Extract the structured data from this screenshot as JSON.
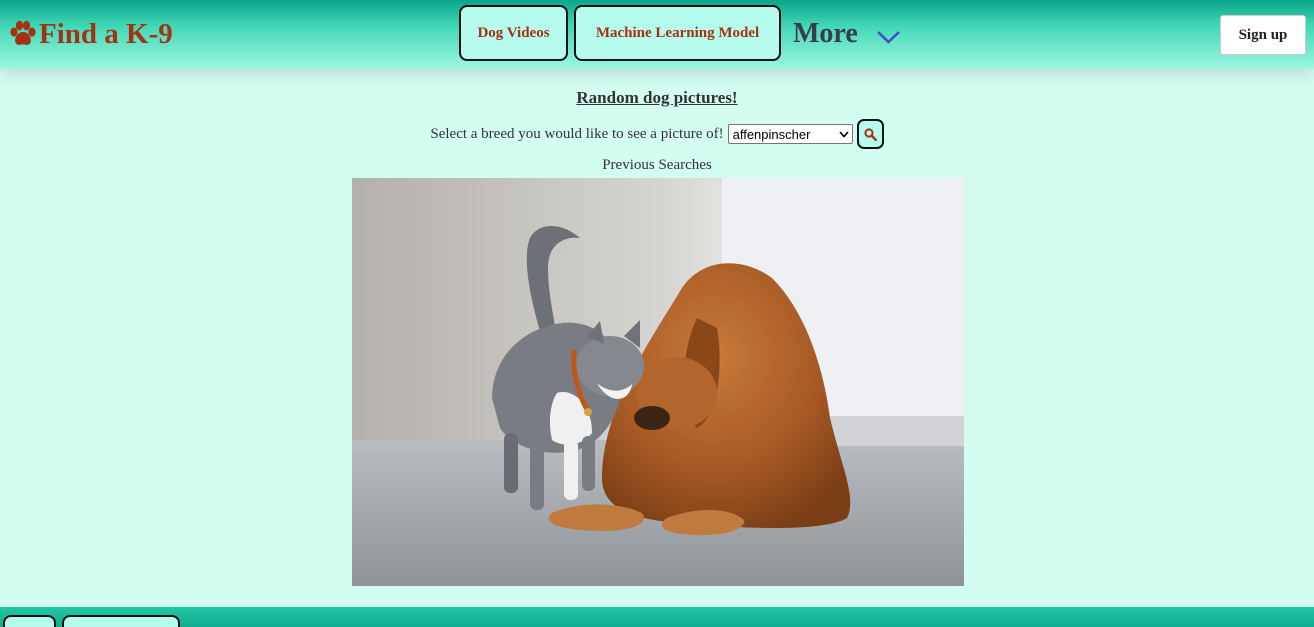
{
  "header": {
    "logo_text": "Find a K-9",
    "logo_icon": "paw-icon",
    "nav": [
      {
        "label": "Dog Videos"
      },
      {
        "label": "Machine Learning Model"
      }
    ],
    "more_label": "More",
    "signup_label": "Sign up"
  },
  "main": {
    "title": "Random dog pictures!",
    "select_label": "Select a breed you would like to see a picture of!",
    "breed_selected": "affenpinscher",
    "search_icon": "search-icon",
    "previous_searches": "Previous Searches",
    "photo_description_icon": "dog-and-cat-photo"
  },
  "colors": {
    "background": "#d3fdf1",
    "header_teal": "#0aa68a",
    "button_fill": "#b5fbee",
    "brand_text": "#a53212"
  }
}
